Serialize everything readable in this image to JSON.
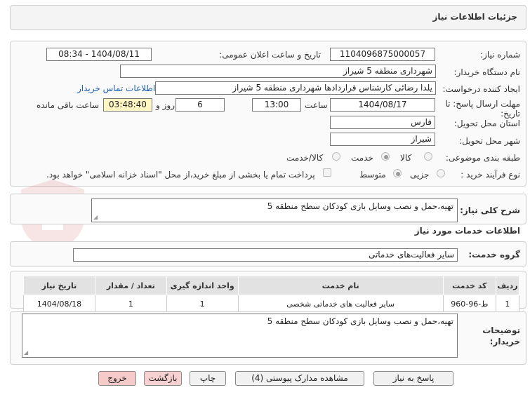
{
  "header": {
    "title": "جزئیات اطلاعات نیاز"
  },
  "form": {
    "need_number_label": "شماره نیاز:",
    "need_number": "1104096875000057",
    "announce_label": "تاریخ و ساعت اعلان عمومی:",
    "announce_value": "1404/08/11 - 08:34",
    "buyer_org_label": "نام دستگاه خریدار:",
    "buyer_org": "شهرداری منطقه 5 شیراز",
    "creator_label": "ایجاد کننده درخواست:",
    "creator": "یلدا رضائی کارشناس قراردادها شهرداری منطقه 5 شیراز",
    "contact_link": "اطلاعات تماس خریدار",
    "deadline_label_1": "مهلت ارسال پاسخ: تا",
    "deadline_label_2": "تاریخ:",
    "deadline_date": "1404/08/17",
    "time_label": "ساعت",
    "deadline_time": "13:00",
    "days_value": "6",
    "days_label": "روز و",
    "remaining_time": "03:48:40",
    "remaining_label": "ساعت باقی مانده",
    "province_label": "استان محل تحویل:",
    "province": "فارس",
    "city_label": "شهر محل تحویل:",
    "city": "شیراز",
    "category_label": "طبقه بندی موضوعی:",
    "category_options": [
      "کالا",
      "خدمت",
      "کالا/خدمت"
    ],
    "process_label": "نوع فرآیند خرید :",
    "process_options": [
      "جزیی",
      "متوسط"
    ],
    "payment_note": "پرداخت تمام یا بخشی از مبلغ خرید،از محل \"اسناد خزانه اسلامی\" خواهد بود."
  },
  "summary": {
    "label": "شرح کلی نیاز:",
    "text": "تهیه،حمل و نصب وسایل بازی کودکان سطح منطقه 5"
  },
  "services": {
    "section_title": "اطلاعات خدمات مورد نیاز",
    "group_label": "گروه خدمت:",
    "group_value": "سایر فعالیت‌های خدماتی",
    "columns": [
      "ردیف",
      "کد خدمت",
      "نام خدمت",
      "واحد اندازه گیری",
      "تعداد / مقدار",
      "تاریخ نیاز"
    ],
    "rows": [
      [
        "1",
        "ط-96-960",
        "سایر فعالیت های خدماتی شخصی",
        "1",
        "1",
        "1404/08/18"
      ]
    ]
  },
  "buyer_notes": {
    "label_1": "توضیحات",
    "label_2": "خریدار:",
    "text": "تهیه،حمل و نصب وسایل بازی کودکان سطح منطقه 5"
  },
  "buttons": {
    "reply": "پاسخ به نیاز",
    "attachments": "مشاهده مدارک پیوستی (4)",
    "print": "چاپ",
    "back": "بازگشت",
    "exit": "خروج"
  },
  "watermark": {
    "text": "AriaTender.net"
  },
  "colors": {
    "accent_link": "#1a5fb4",
    "remaining_bg": "#fff6c4",
    "exit_bg": "#f7caca",
    "watermark": "#c62828"
  }
}
